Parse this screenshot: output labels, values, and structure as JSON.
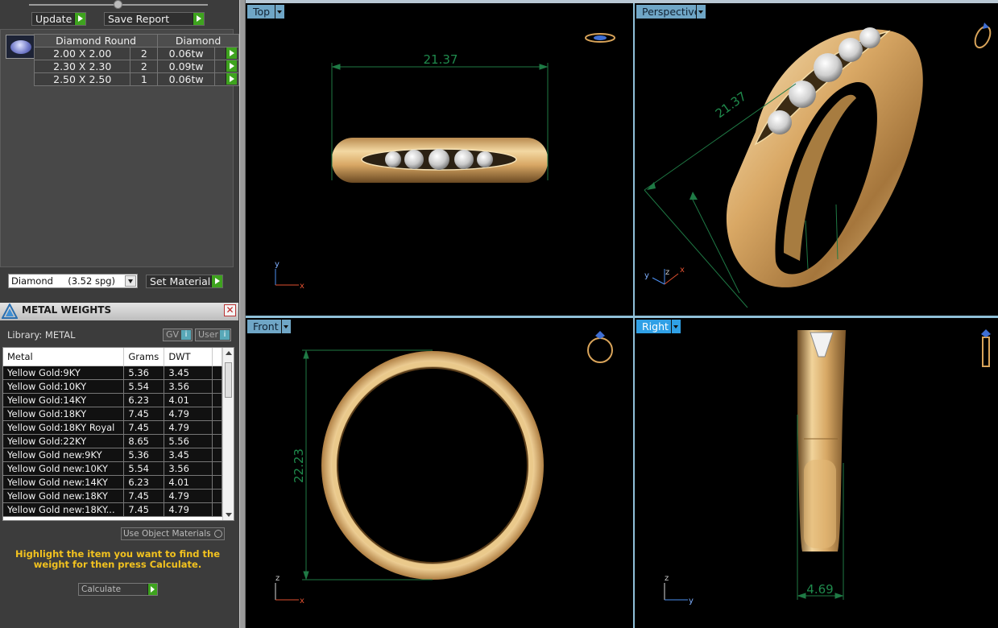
{
  "toolbar": {
    "update_label": "Update",
    "save_report_label": "Save Report"
  },
  "diamonds": {
    "headers": [
      "Diamond Round",
      "Diamond"
    ],
    "rows": [
      {
        "size": "2.00 X 2.00",
        "count": "2",
        "weight": "0.06tw"
      },
      {
        "size": "2.30 X 2.30",
        "count": "2",
        "weight": "0.09tw"
      },
      {
        "size": "2.50 X 2.50",
        "count": "1",
        "weight": "0.06tw"
      }
    ]
  },
  "material": {
    "selected": "Diamond     (3.52 spg)",
    "set_label": "Set Material"
  },
  "metal_weights": {
    "title": "METAL WEIGHTS",
    "library_label": "Library: METAL",
    "toggle_gv": "GV",
    "toggle_user": "User",
    "columns": [
      "Metal",
      "Grams",
      "DWT"
    ],
    "rows": [
      [
        "Yellow Gold:9KY",
        "5.36",
        "3.45"
      ],
      [
        "Yellow Gold:10KY",
        "5.54",
        "3.56"
      ],
      [
        "Yellow Gold:14KY",
        "6.23",
        "4.01"
      ],
      [
        "Yellow Gold:18KY",
        "7.45",
        "4.79"
      ],
      [
        "Yellow Gold:18KY Royal",
        "7.45",
        "4.79"
      ],
      [
        "Yellow Gold:22KY",
        "8.65",
        "5.56"
      ],
      [
        "Yellow Gold new:9KY",
        "5.36",
        "3.45"
      ],
      [
        "Yellow Gold new:10KY",
        "5.54",
        "3.56"
      ],
      [
        "Yellow Gold new:14KY",
        "6.23",
        "4.01"
      ],
      [
        "Yellow Gold new:18KY",
        "7.45",
        "4.79"
      ],
      [
        "Yellow Gold new:18KY...",
        "7.45",
        "4.79"
      ]
    ],
    "use_object_materials": "Use Object Materials",
    "hint": "Highlight the item you want to find the weight for then press Calculate.",
    "calculate_label": "Calculate"
  },
  "viewports": {
    "top": {
      "label": "Top",
      "dimension": "21.37"
    },
    "perspective": {
      "label": "Perspective",
      "dimension": "21.37"
    },
    "front": {
      "label": "Front",
      "dimension": "22.23"
    },
    "right": {
      "label": "Right",
      "dimension": "4.69"
    },
    "axes": {
      "x": "x",
      "y": "y",
      "z": "z"
    }
  },
  "colors": {
    "gold": "#d9a85c",
    "dimension_line": "#1f7a45",
    "active_tab": "#2fa0e6",
    "tab": "#6fa6c6"
  }
}
